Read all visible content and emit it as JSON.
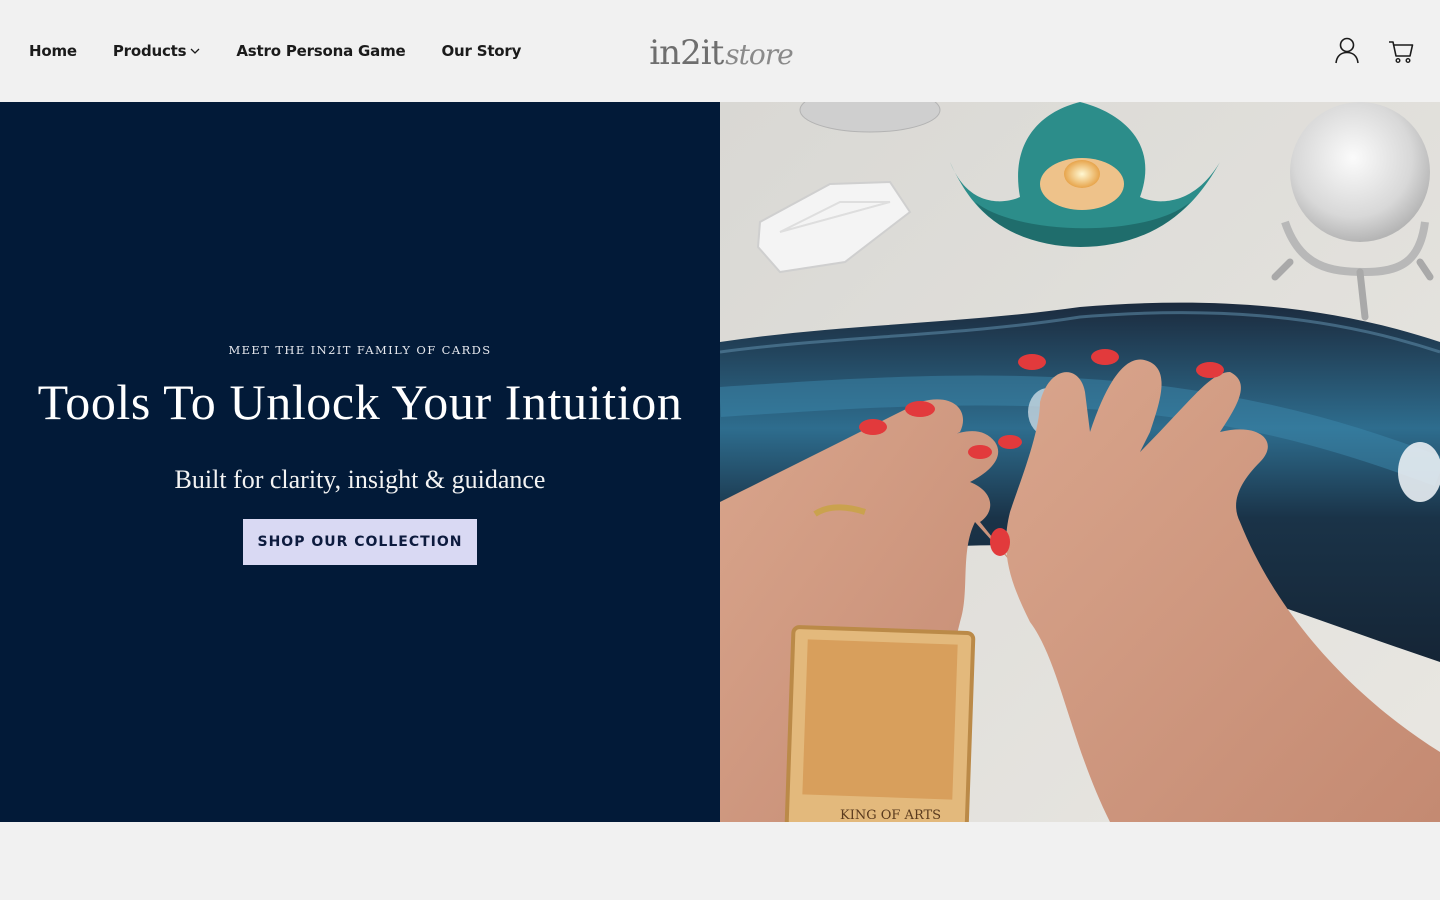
{
  "header": {
    "nav": [
      {
        "label": "Home"
      },
      {
        "label": "Products"
      },
      {
        "label": "Astro Persona Game"
      },
      {
        "label": "Our Story"
      }
    ],
    "logo": {
      "main": "in2it",
      "sub": "store"
    },
    "icons": [
      "account-icon",
      "cart-icon"
    ]
  },
  "hero": {
    "eyebrow": "MEET THE IN2IT FAMILY OF CARDS",
    "headline": "Tools To Unlock Your Intuition",
    "subline": "Built for clarity, insight & guidance",
    "cta_label": "SHOP OUR COLLECTION",
    "card_caption": "KING OF ARTS",
    "colors": {
      "panel": "#021a38",
      "button": "#d9d9f3",
      "button_text": "#0d1b3e"
    }
  }
}
